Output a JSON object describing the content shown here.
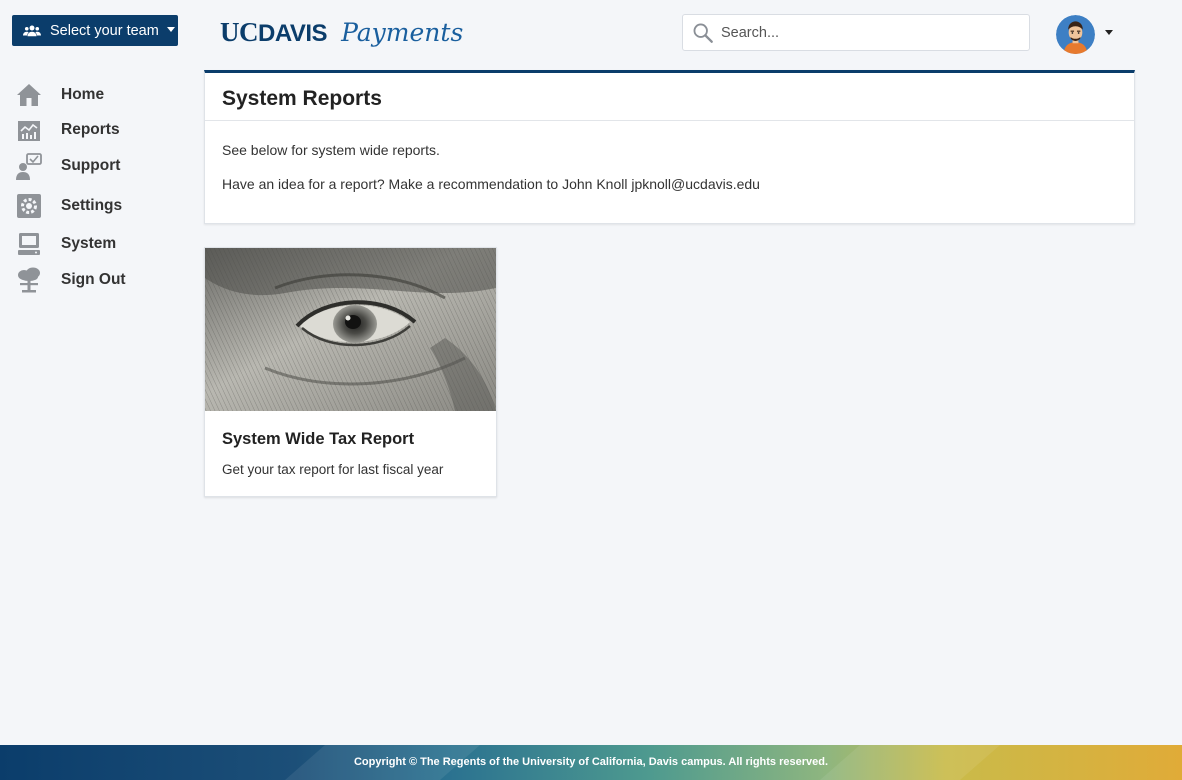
{
  "header": {
    "team_select_label": "Select your team",
    "logo_uc": "UC",
    "logo_davis": "DAVIS",
    "logo_product": "Payments",
    "search_placeholder": "Search...",
    "search_value": ""
  },
  "sidebar": {
    "items": [
      {
        "label": "Home",
        "icon": "home-icon"
      },
      {
        "label": "Reports",
        "icon": "chart-icon"
      },
      {
        "label": "Support",
        "icon": "support-icon"
      },
      {
        "label": "Settings",
        "icon": "gear-icon"
      },
      {
        "label": "System",
        "icon": "computer-icon"
      },
      {
        "label": "Sign Out",
        "icon": "signout-icon"
      }
    ]
  },
  "main": {
    "title": "System Reports",
    "intro": "See below for system wide reports.",
    "recommendation": "Have an idea for a report? Make a recommendation to John Knoll jpknoll@ucdavis.edu",
    "reports": [
      {
        "title": "System Wide Tax Report",
        "description": "Get your tax report for last fiscal year",
        "image": "money-eye-image"
      }
    ]
  },
  "footer": {
    "copyright": "Copyright © The Regents of the University of California, Davis campus. All rights reserved."
  },
  "colors": {
    "brand_navy": "#0b3d6b",
    "page_bg": "#f4f6f9",
    "footer_gold": "#d9ad3c"
  }
}
